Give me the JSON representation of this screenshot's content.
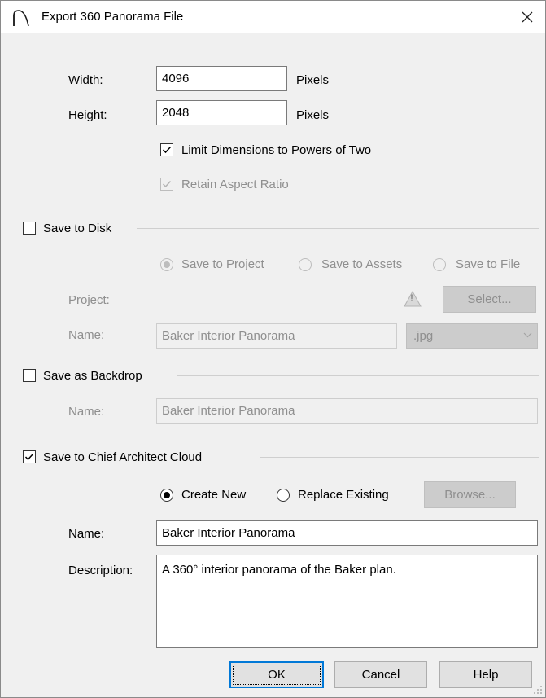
{
  "window": {
    "title": "Export 360 Panorama File",
    "close_glyph": "✕"
  },
  "dimensions": {
    "width_label": "Width:",
    "width_value": "4096",
    "width_unit": "Pixels",
    "height_label": "Height:",
    "height_value": "2048",
    "height_unit": "Pixels",
    "limit_label": "Limit Dimensions to Powers of Two",
    "limit_checked": true,
    "aspect_label": "Retain Aspect Ratio",
    "aspect_checked": true
  },
  "save_to_disk": {
    "label": "Save to Disk",
    "checked": false,
    "radio_project": "Save to Project",
    "radio_assets": "Save to Assets",
    "radio_file": "Save to File",
    "project_label": "Project:",
    "warning_glyph": "!",
    "select_button": "Select...",
    "name_label": "Name:",
    "name_value": "Baker Interior Panorama",
    "format_value": ".jpg"
  },
  "save_as_backdrop": {
    "label": "Save as Backdrop",
    "checked": false,
    "name_label": "Name:",
    "name_value": "Baker Interior Panorama"
  },
  "cloud": {
    "label": "Save to Chief Architect Cloud",
    "checked": true,
    "radio_create": "Create New",
    "radio_replace": "Replace Existing",
    "browse_button": "Browse...",
    "name_label": "Name:",
    "name_value": "Baker Interior Panorama",
    "description_label": "Description:",
    "description_value": "A 360° interior panorama of the Baker plan."
  },
  "buttons": {
    "ok": "OK",
    "cancel": "Cancel",
    "help": "Help"
  },
  "icons": [
    "app-arch-icon",
    "close-icon",
    "checkmark-icon",
    "warning-icon",
    "chevron-down-icon",
    "resize-grip-icon"
  ],
  "colors": {
    "dialog_bg": "#f0f0f0",
    "accent": "#0078d7",
    "disabled_text": "#8f8f8f"
  }
}
